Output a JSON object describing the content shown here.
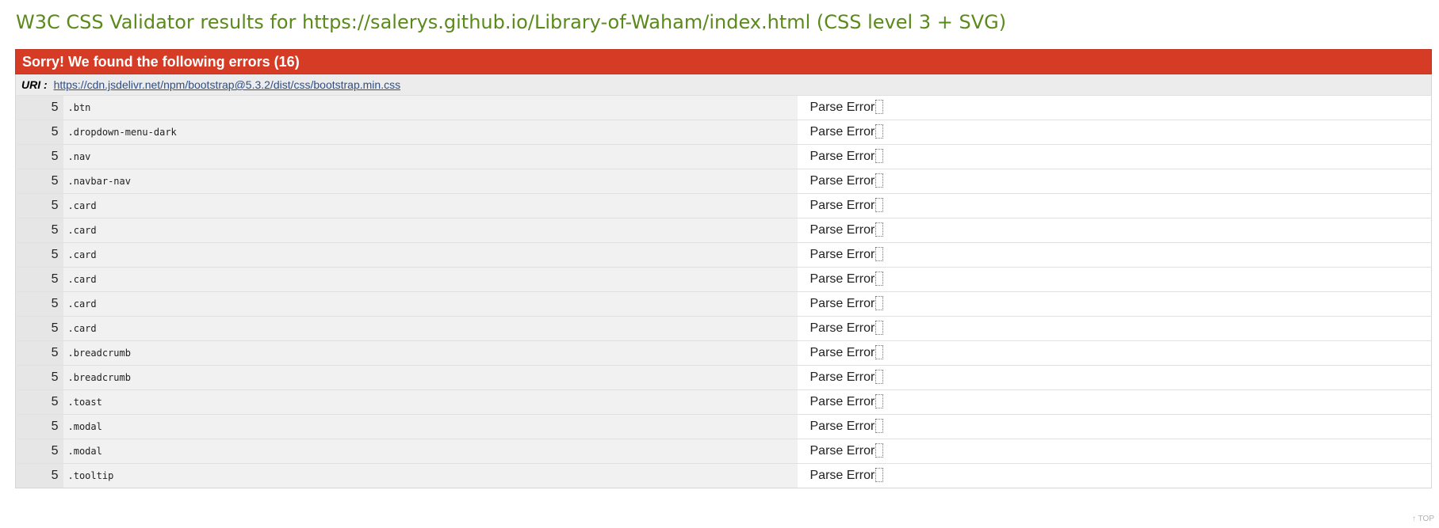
{
  "title": "W3C CSS Validator results for https://salerys.github.io/Library-of-Waham/index.html (CSS level 3 + SVG)",
  "error_section": {
    "header": "Sorry! We found the following errors (16)",
    "uri_label": "URI :",
    "uri_link": "https://cdn.jsdelivr.net/npm/bootstrap@5.3.2/dist/css/bootstrap.min.css",
    "rows": [
      {
        "line": "5",
        "context": ".btn",
        "message": "Parse Error"
      },
      {
        "line": "5",
        "context": ".dropdown-menu-dark",
        "message": "Parse Error"
      },
      {
        "line": "5",
        "context": ".nav",
        "message": "Parse Error"
      },
      {
        "line": "5",
        "context": ".navbar-nav",
        "message": "Parse Error"
      },
      {
        "line": "5",
        "context": ".card",
        "message": "Parse Error"
      },
      {
        "line": "5",
        "context": ".card",
        "message": "Parse Error"
      },
      {
        "line": "5",
        "context": ".card",
        "message": "Parse Error"
      },
      {
        "line": "5",
        "context": ".card",
        "message": "Parse Error"
      },
      {
        "line": "5",
        "context": ".card",
        "message": "Parse Error"
      },
      {
        "line": "5",
        "context": ".card",
        "message": "Parse Error"
      },
      {
        "line": "5",
        "context": ".breadcrumb",
        "message": "Parse Error"
      },
      {
        "line": "5",
        "context": ".breadcrumb",
        "message": "Parse Error"
      },
      {
        "line": "5",
        "context": ".toast",
        "message": "Parse Error"
      },
      {
        "line": "5",
        "context": ".modal",
        "message": "Parse Error"
      },
      {
        "line": "5",
        "context": ".modal",
        "message": "Parse Error"
      },
      {
        "line": "5",
        "context": ".tooltip",
        "message": "Parse Error"
      }
    ]
  },
  "top_link": "↑ TOP",
  "colors": {
    "title": "#5a8a19",
    "error_header_bg": "#d63c25",
    "link": "#2d4f86"
  }
}
